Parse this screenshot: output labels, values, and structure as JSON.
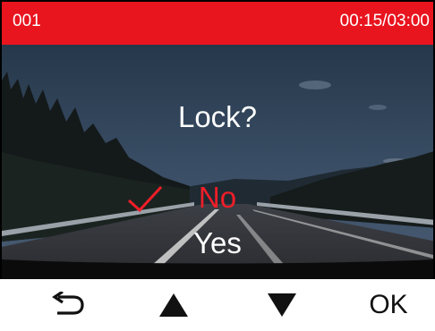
{
  "status_bar": {
    "file_index": "001",
    "playback_time": "00:15/03:00",
    "bar_color": "#e8141e"
  },
  "dialog": {
    "title": "Lock?",
    "options": [
      {
        "label": "No",
        "selected": true,
        "color": "#f01e28"
      },
      {
        "label": "Yes",
        "selected": false,
        "color": "#ffffff"
      }
    ],
    "selected_marker": "checkmark-icon"
  },
  "buttons": {
    "back": "back-arrow-icon",
    "up": "up-triangle-icon",
    "down": "down-triangle-icon",
    "ok_label": "OK"
  }
}
